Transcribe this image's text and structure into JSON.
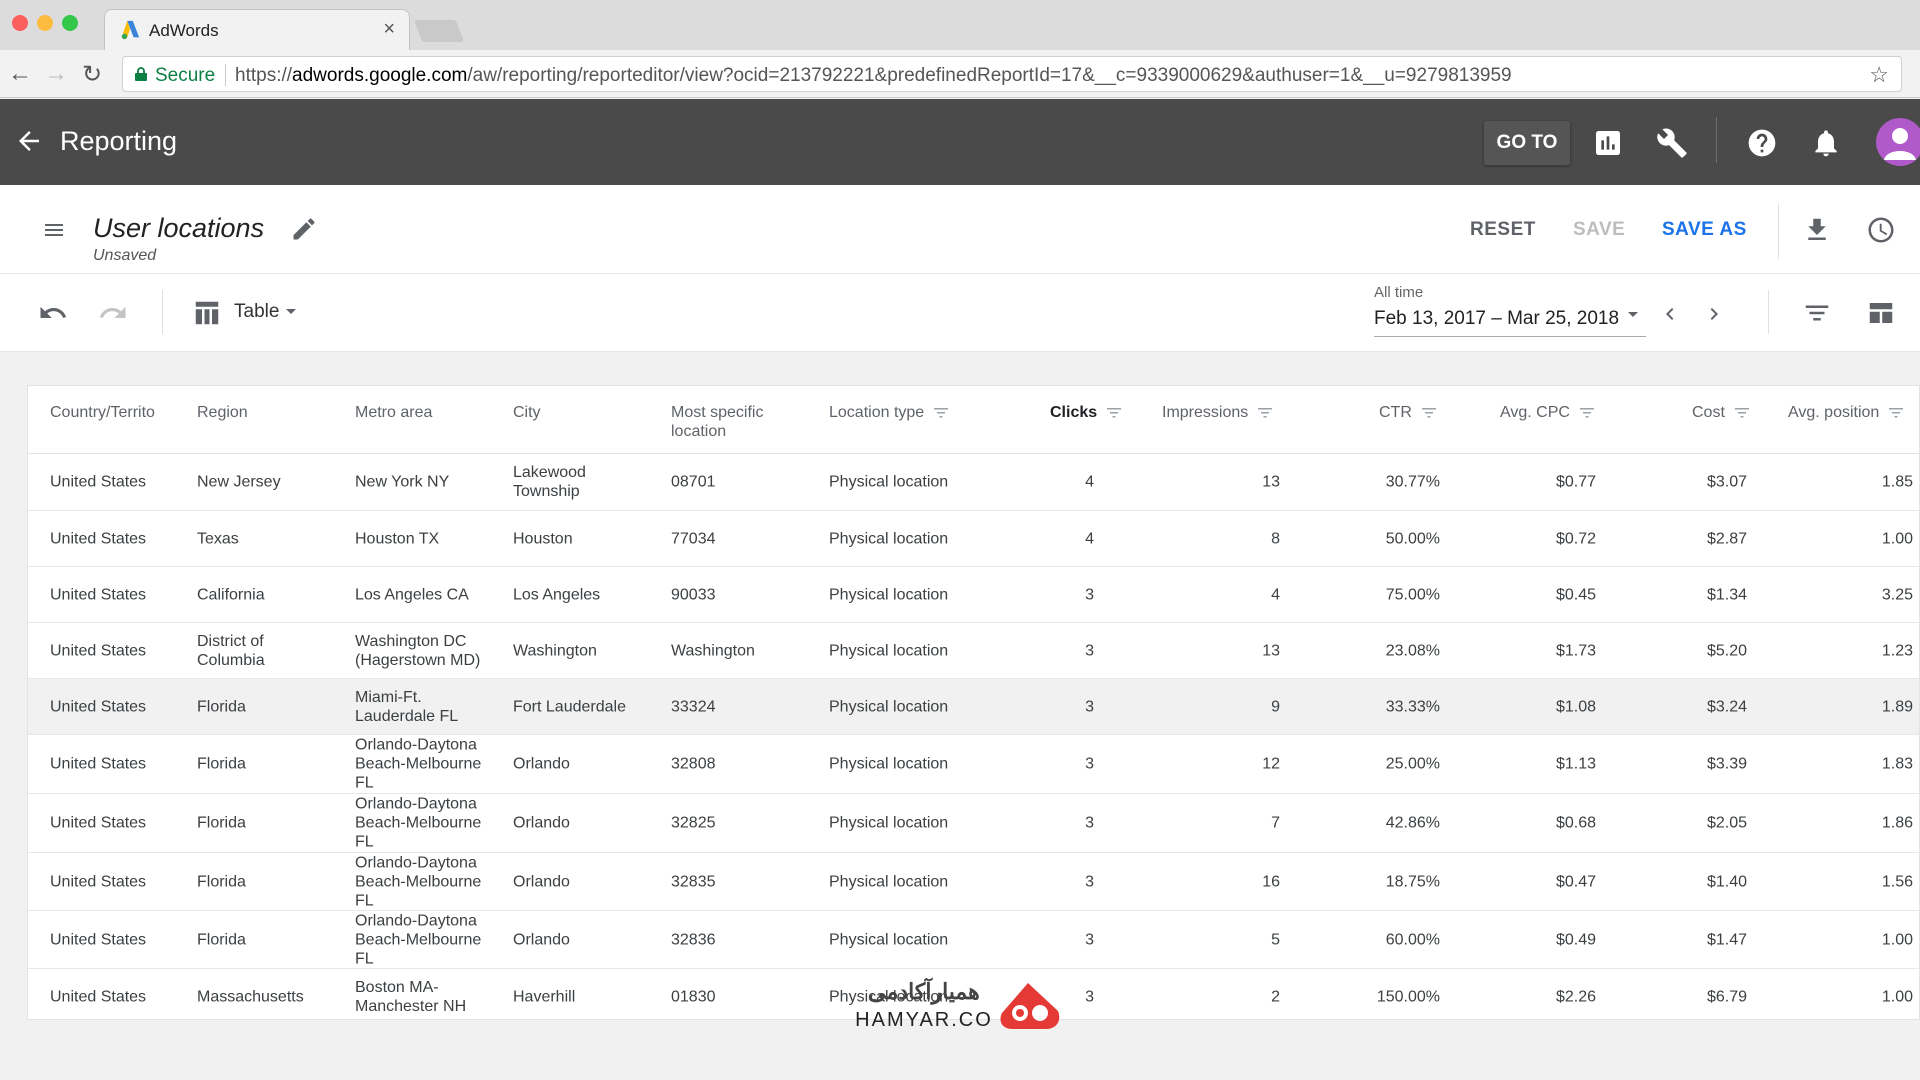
{
  "browser": {
    "tab_title": "AdWords",
    "tab_close": "×",
    "secure_label": "Secure",
    "url_scheme": "https://",
    "url_host": "adwords.google.com",
    "url_path": "/aw/reporting/reporteditor/view?ocid=213792221&predefinedReportId=17&__c=9339000629&authuser=1&__u=9279813959",
    "traffic_colors": [
      "#fc605c",
      "#fdbc40",
      "#34c84a"
    ]
  },
  "header": {
    "title": "Reporting",
    "goto_label": "GO TO",
    "background": "#4a4a4a",
    "icons": [
      "back-arrow-icon",
      "reports-icon",
      "wrench-icon",
      "help-icon",
      "bell-icon",
      "account-icon"
    ]
  },
  "report": {
    "title": "User locations",
    "status": "Unsaved",
    "reset_label": "RESET",
    "save_label": "SAVE",
    "save_as_label": "SAVE AS",
    "accent": "#1a73e8"
  },
  "toolbar": {
    "view_label": "Table",
    "date_range_label": "All time",
    "date_range_value": "Feb 13, 2017 – Mar 25, 2018"
  },
  "table": {
    "columns": [
      {
        "label": "Country/Territo"
      },
      {
        "label": "Region"
      },
      {
        "label": "Metro area"
      },
      {
        "label": "City"
      },
      {
        "label": "Most specific location"
      },
      {
        "label": "Location type"
      },
      {
        "label": "Clicks"
      },
      {
        "label": "Impressions"
      },
      {
        "label": "CTR"
      },
      {
        "label": "Avg. CPC"
      },
      {
        "label": "Cost"
      },
      {
        "label": "Avg. position"
      }
    ],
    "rows": [
      [
        "United States",
        "New Jersey",
        "New York NY",
        "Lakewood Township",
        "08701",
        "Physical location",
        "4",
        "13",
        "30.77%",
        "$0.77",
        "$3.07",
        "1.85"
      ],
      [
        "United States",
        "Texas",
        "Houston TX",
        "Houston",
        "77034",
        "Physical location",
        "4",
        "8",
        "50.00%",
        "$0.72",
        "$2.87",
        "1.00"
      ],
      [
        "United States",
        "California",
        "Los Angeles CA",
        "Los Angeles",
        "90033",
        "Physical location",
        "3",
        "4",
        "75.00%",
        "$0.45",
        "$1.34",
        "3.25"
      ],
      [
        "United States",
        "District of Columbia",
        "Washington DC (Hagerstown MD)",
        "Washington",
        "Washington",
        "Physical location",
        "3",
        "13",
        "23.08%",
        "$1.73",
        "$5.20",
        "1.23"
      ],
      [
        "United States",
        "Florida",
        "Miami-Ft. Lauderdale FL",
        "Fort Lauderdale",
        "33324",
        "Physical location",
        "3",
        "9",
        "33.33%",
        "$1.08",
        "$3.24",
        "1.89"
      ],
      [
        "United States",
        "Florida",
        "Orlando-Daytona Beach-Melbourne FL",
        "Orlando",
        "32808",
        "Physical location",
        "3",
        "12",
        "25.00%",
        "$1.13",
        "$3.39",
        "1.83"
      ],
      [
        "United States",
        "Florida",
        "Orlando-Daytona Beach-Melbourne FL",
        "Orlando",
        "32825",
        "Physical location",
        "3",
        "7",
        "42.86%",
        "$0.68",
        "$2.05",
        "1.86"
      ],
      [
        "United States",
        "Florida",
        "Orlando-Daytona Beach-Melbourne FL",
        "Orlando",
        "32835",
        "Physical location",
        "3",
        "16",
        "18.75%",
        "$0.47",
        "$1.40",
        "1.56"
      ],
      [
        "United States",
        "Florida",
        "Orlando-Daytona Beach-Melbourne FL",
        "Orlando",
        "32836",
        "Physical location",
        "3",
        "5",
        "60.00%",
        "$0.49",
        "$1.47",
        "1.00"
      ],
      [
        "United States",
        "Massachusetts",
        "Boston MA-Manchester NH",
        "Haverhill",
        "01830",
        "Physical location",
        "3",
        "2",
        "150.00%",
        "$2.26",
        "$6.79",
        "1.00"
      ]
    ]
  },
  "watermark": {
    "text_fa": "همیارآکادمی",
    "text_en": "HAMYAR.CO"
  }
}
